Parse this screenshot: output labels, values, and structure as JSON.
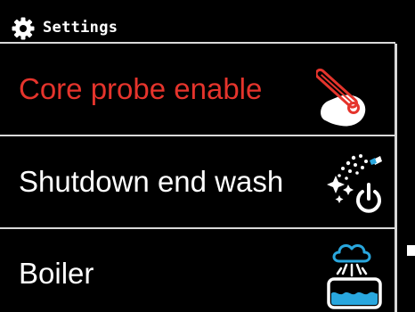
{
  "header": {
    "title": "Settings",
    "icon": "gear-icon"
  },
  "menu": {
    "items": [
      {
        "label": "Core probe enable",
        "icon": "core-probe-icon",
        "active": true
      },
      {
        "label": "Shutdown end wash",
        "icon": "shutdown-wash-icon",
        "active": false
      },
      {
        "label": "Boiler",
        "icon": "boiler-icon",
        "active": false
      }
    ]
  },
  "colors": {
    "background": "#000000",
    "text": "#ffffff",
    "active_text": "#e5342c",
    "divider": "#d9d9d9",
    "icon_blue": "#29a7de",
    "icon_red": "#e5342c"
  }
}
